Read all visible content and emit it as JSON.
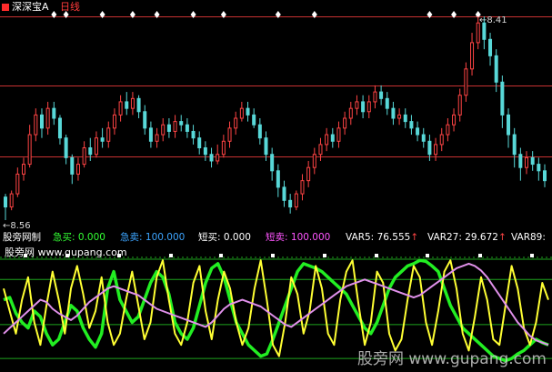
{
  "header": {
    "title": "深深宝A",
    "period": "日线"
  },
  "price_panel": {
    "high_label": "8.41",
    "low_label": "8.56"
  },
  "indicator": {
    "name": "股旁网制",
    "items": [
      {
        "label": "急买:",
        "value": "0.000",
        "color": "#33ff33"
      },
      {
        "label": "急卖:",
        "value": "100.000",
        "color": "#3da5ff"
      },
      {
        "label": "短买:",
        "value": "0.000",
        "color": "#ffffff"
      },
      {
        "label": "短卖:",
        "value": "100.000",
        "color": "#ff55ff"
      },
      {
        "label": "VAR5:",
        "value": "76.555",
        "color": "#ffffff",
        "arrow": "↑"
      },
      {
        "label": "VAR27:",
        "value": "29.672",
        "color": "#ffffff",
        "arrow": "↑"
      },
      {
        "label": "VAR89:",
        "value": "",
        "color": "#ffffff"
      }
    ]
  },
  "watermarks": {
    "left": "股旁网 www.gupang.com",
    "right": "股旁网 www.gupang.com"
  },
  "colors": {
    "up": "#ff4444",
    "down": "#58d8d8",
    "grid": "#c83232",
    "green": "#22ee22",
    "yellow": "#ffff33",
    "violet": "#e090ea"
  },
  "chart_data": {
    "type": "candlestick",
    "candles": [
      [
        45,
        42,
        46,
        38
      ],
      [
        42,
        46,
        47,
        41
      ],
      [
        46,
        52,
        54,
        45
      ],
      [
        52,
        55,
        57,
        50
      ],
      [
        55,
        64,
        67,
        54
      ],
      [
        64,
        70,
        72,
        62
      ],
      [
        70,
        66,
        72,
        63
      ],
      [
        66,
        72,
        74,
        64
      ],
      [
        72,
        69,
        74,
        67
      ],
      [
        69,
        63,
        70,
        61
      ],
      [
        63,
        57,
        64,
        55
      ],
      [
        57,
        52,
        58,
        49
      ],
      [
        52,
        55,
        57,
        50
      ],
      [
        55,
        60,
        62,
        54
      ],
      [
        60,
        58,
        63,
        56
      ],
      [
        58,
        63,
        65,
        57
      ],
      [
        63,
        62,
        66,
        60
      ],
      [
        62,
        66,
        68,
        60
      ],
      [
        66,
        70,
        72,
        64
      ],
      [
        70,
        74,
        76,
        68
      ],
      [
        74,
        72,
        77,
        70
      ],
      [
        72,
        75,
        77,
        70
      ],
      [
        75,
        71,
        76,
        69
      ],
      [
        71,
        66,
        73,
        64
      ],
      [
        66,
        62,
        68,
        60
      ],
      [
        62,
        64,
        66,
        60
      ],
      [
        64,
        67,
        69,
        62
      ],
      [
        67,
        65,
        69,
        63
      ],
      [
        65,
        68,
        70,
        63
      ],
      [
        68,
        67,
        70,
        65
      ],
      [
        67,
        65,
        69,
        63
      ],
      [
        65,
        63,
        67,
        61
      ],
      [
        63,
        60,
        65,
        58
      ],
      [
        60,
        58,
        62,
        56
      ],
      [
        58,
        56,
        60,
        54
      ],
      [
        56,
        58,
        61,
        55
      ],
      [
        58,
        62,
        64,
        57
      ],
      [
        62,
        66,
        68,
        60
      ],
      [
        66,
        69,
        71,
        64
      ],
      [
        69,
        72,
        74,
        68
      ],
      [
        72,
        70,
        74,
        68
      ],
      [
        70,
        67,
        72,
        66
      ],
      [
        67,
        63,
        69,
        61
      ],
      [
        63,
        58,
        65,
        56
      ],
      [
        58,
        53,
        60,
        50
      ],
      [
        53,
        48,
        55,
        45
      ],
      [
        48,
        44,
        50,
        42
      ],
      [
        44,
        42,
        46,
        40
      ],
      [
        42,
        46,
        47,
        41
      ],
      [
        46,
        50,
        52,
        44
      ],
      [
        50,
        54,
        56,
        48
      ],
      [
        54,
        58,
        60,
        52
      ],
      [
        58,
        61,
        63,
        56
      ],
      [
        61,
        64,
        66,
        59
      ],
      [
        64,
        62,
        66,
        60
      ],
      [
        62,
        66,
        68,
        60
      ],
      [
        66,
        69,
        71,
        64
      ],
      [
        69,
        72,
        74,
        67
      ],
      [
        72,
        74,
        76,
        70
      ],
      [
        74,
        71,
        76,
        69
      ],
      [
        71,
        74,
        76,
        69
      ],
      [
        74,
        77,
        79,
        72
      ],
      [
        77,
        75,
        79,
        73
      ],
      [
        75,
        72,
        77,
        70
      ],
      [
        72,
        69,
        74,
        67
      ],
      [
        69,
        70,
        72,
        67
      ],
      [
        70,
        68,
        72,
        66
      ],
      [
        68,
        66,
        70,
        64
      ],
      [
        66,
        64,
        68,
        62
      ],
      [
        64,
        62,
        66,
        60
      ],
      [
        62,
        58,
        64,
        56
      ],
      [
        58,
        61,
        63,
        56
      ],
      [
        61,
        64,
        66,
        59
      ],
      [
        64,
        67,
        69,
        62
      ],
      [
        67,
        70,
        72,
        65
      ],
      [
        70,
        76,
        78,
        68
      ],
      [
        76,
        84,
        86,
        74
      ],
      [
        84,
        92,
        95,
        82
      ],
      [
        92,
        98,
        100,
        90
      ],
      [
        98,
        93,
        100,
        90
      ],
      [
        93,
        88,
        95,
        85
      ],
      [
        88,
        80,
        90,
        77
      ],
      [
        80,
        70,
        82,
        66
      ],
      [
        70,
        64,
        72,
        60
      ],
      [
        64,
        58,
        66,
        54
      ],
      [
        58,
        54,
        60,
        50
      ],
      [
        54,
        57,
        59,
        52
      ],
      [
        57,
        55,
        59,
        53
      ],
      [
        55,
        53,
        57,
        50
      ],
      [
        53,
        50,
        55,
        48
      ]
    ],
    "oscillator": {
      "y_range": [
        0,
        100
      ],
      "levels": [
        8,
        38,
        78,
        96
      ],
      "series": [
        {
          "name": "急买",
          "values": [
            60,
            62,
            48,
            40,
            35,
            50,
            45,
            30,
            20,
            25,
            40,
            55,
            50,
            35,
            25,
            18,
            30,
            70,
            85,
            60,
            50,
            40,
            45,
            60,
            75,
            85,
            80,
            65,
            40,
            30,
            25,
            35,
            55,
            75,
            88,
            92,
            80,
            60,
            40,
            30,
            20,
            15,
            10,
            12,
            25,
            40,
            55,
            70,
            85,
            92,
            90,
            88,
            85,
            80,
            75,
            70,
            65,
            55,
            45,
            35,
            30,
            40,
            55,
            70,
            80,
            85,
            90,
            92,
            95,
            94,
            90,
            85,
            70,
            55,
            45,
            35,
            30,
            25,
            20,
            15,
            10,
            8,
            6,
            8,
            12,
            15,
            20,
            25,
            22,
            20
          ]
        },
        {
          "name": "急卖",
          "values": [
            70,
            50,
            30,
            60,
            80,
            40,
            20,
            55,
            85,
            60,
            30,
            70,
            90,
            65,
            35,
            50,
            80,
            40,
            20,
            30,
            60,
            85,
            55,
            25,
            40,
            80,
            95,
            60,
            30,
            20,
            40,
            75,
            90,
            50,
            25,
            60,
            85,
            70,
            40,
            20,
            35,
            70,
            95,
            60,
            20,
            10,
            40,
            80,
            65,
            30,
            50,
            90,
            70,
            30,
            20,
            60,
            85,
            95,
            55,
            20,
            40,
            85,
            75,
            30,
            15,
            25,
            60,
            90,
            80,
            40,
            20,
            50,
            85,
            95,
            70,
            30,
            15,
            45,
            80,
            60,
            25,
            20,
            55,
            90,
            70,
            35,
            20,
            40,
            75,
            60
          ]
        },
        {
          "name": "短卖",
          "values": [
            30,
            35,
            40,
            45,
            50,
            55,
            60,
            58,
            52,
            48,
            45,
            42,
            46,
            52,
            58,
            62,
            66,
            70,
            72,
            70,
            68,
            66,
            64,
            60,
            56,
            52,
            50,
            48,
            46,
            44,
            42,
            40,
            38,
            36,
            40,
            46,
            52,
            56,
            58,
            60,
            58,
            56,
            54,
            50,
            46,
            42,
            38,
            36,
            40,
            44,
            48,
            52,
            56,
            60,
            64,
            68,
            72,
            74,
            76,
            78,
            76,
            74,
            72,
            70,
            68,
            66,
            64,
            62,
            64,
            68,
            72,
            76,
            80,
            84,
            88,
            90,
            92,
            90,
            86,
            80,
            72,
            64,
            56,
            48,
            40,
            34,
            28,
            24,
            22,
            20
          ]
        }
      ]
    }
  }
}
